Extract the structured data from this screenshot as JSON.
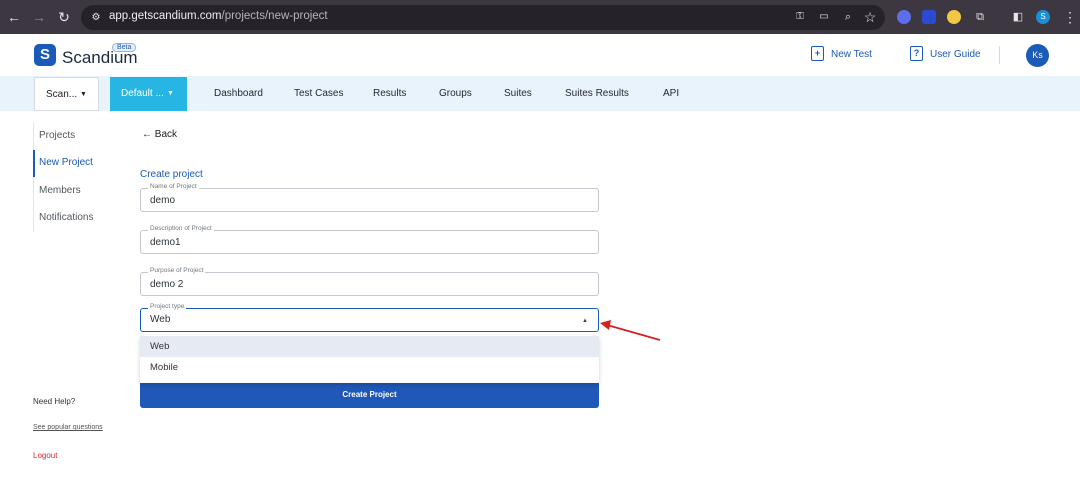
{
  "browser": {
    "url_domain": "app.getscandium.com",
    "url_path": "/projects/new-project"
  },
  "header": {
    "brand": "Scandium",
    "beta": "Beta",
    "new_test": "New Test",
    "user_guide": "User Guide",
    "avatar": "Ks"
  },
  "nav": {
    "org": "Scan...",
    "project": "Default ...",
    "items": [
      "Dashboard",
      "Test Cases",
      "Results",
      "Groups",
      "Suites",
      "Suites Results",
      "API"
    ]
  },
  "sidebar": {
    "items": [
      "Projects",
      "New Project",
      "Members",
      "Notifications"
    ]
  },
  "main": {
    "back": "Back",
    "form_title": "Create project",
    "fields": [
      {
        "label": "Name of Project",
        "value": "demo"
      },
      {
        "label": "Description of Project",
        "value": "demo1"
      },
      {
        "label": "Purpose of Project",
        "value": "demo 2"
      },
      {
        "label": "Project type",
        "value": "Web"
      }
    ],
    "options": [
      "Web",
      "Mobile"
    ],
    "submit": "Create Project"
  },
  "help": {
    "title": "Need Help?",
    "link": "See popular questions",
    "logout": "Logout"
  },
  "colors": {
    "brand": "#1a5ab8",
    "accent": "#27b6e3",
    "logout": "#d32f2f",
    "arrow": "#d62020"
  }
}
